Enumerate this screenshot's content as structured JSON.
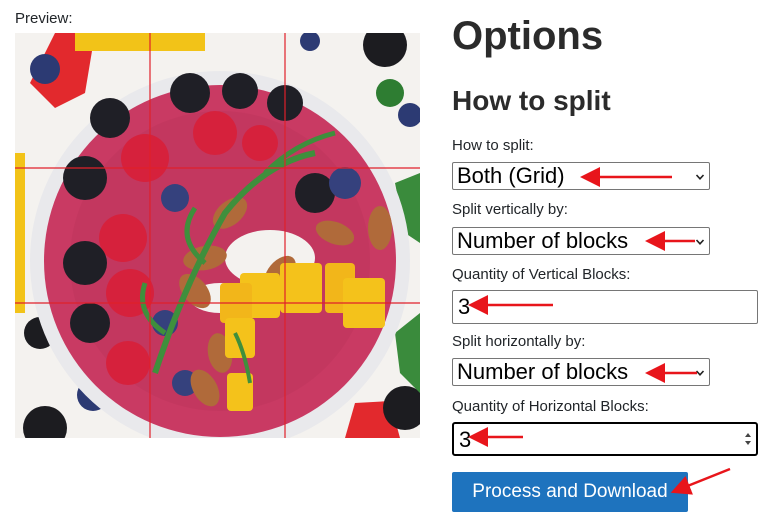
{
  "preview": {
    "label": "Preview:",
    "image_description_icon": "fruit-smoothie-bowl-image",
    "grid_line_color": "#e0202a",
    "grid": {
      "vertical_blocks": 3,
      "horizontal_blocks": 3
    }
  },
  "options": {
    "title": "Options",
    "section_title": "How to split",
    "how_to_split": {
      "label": "How to split:",
      "value": "Both (Grid)"
    },
    "split_vertically": {
      "label": "Split vertically by:",
      "value": "Number of blocks"
    },
    "vertical_quantity": {
      "label": "Quantity of Vertical Blocks:",
      "value": "3"
    },
    "split_horizontally": {
      "label": "Split horizontally by:",
      "value": "Number of blocks"
    },
    "horizontal_quantity": {
      "label": "Quantity of Horizontal Blocks:",
      "value": "3"
    },
    "submit_label": "Process and Download"
  },
  "colors": {
    "accent_button": "#1e73be",
    "annotation_arrow": "#e8151b"
  }
}
